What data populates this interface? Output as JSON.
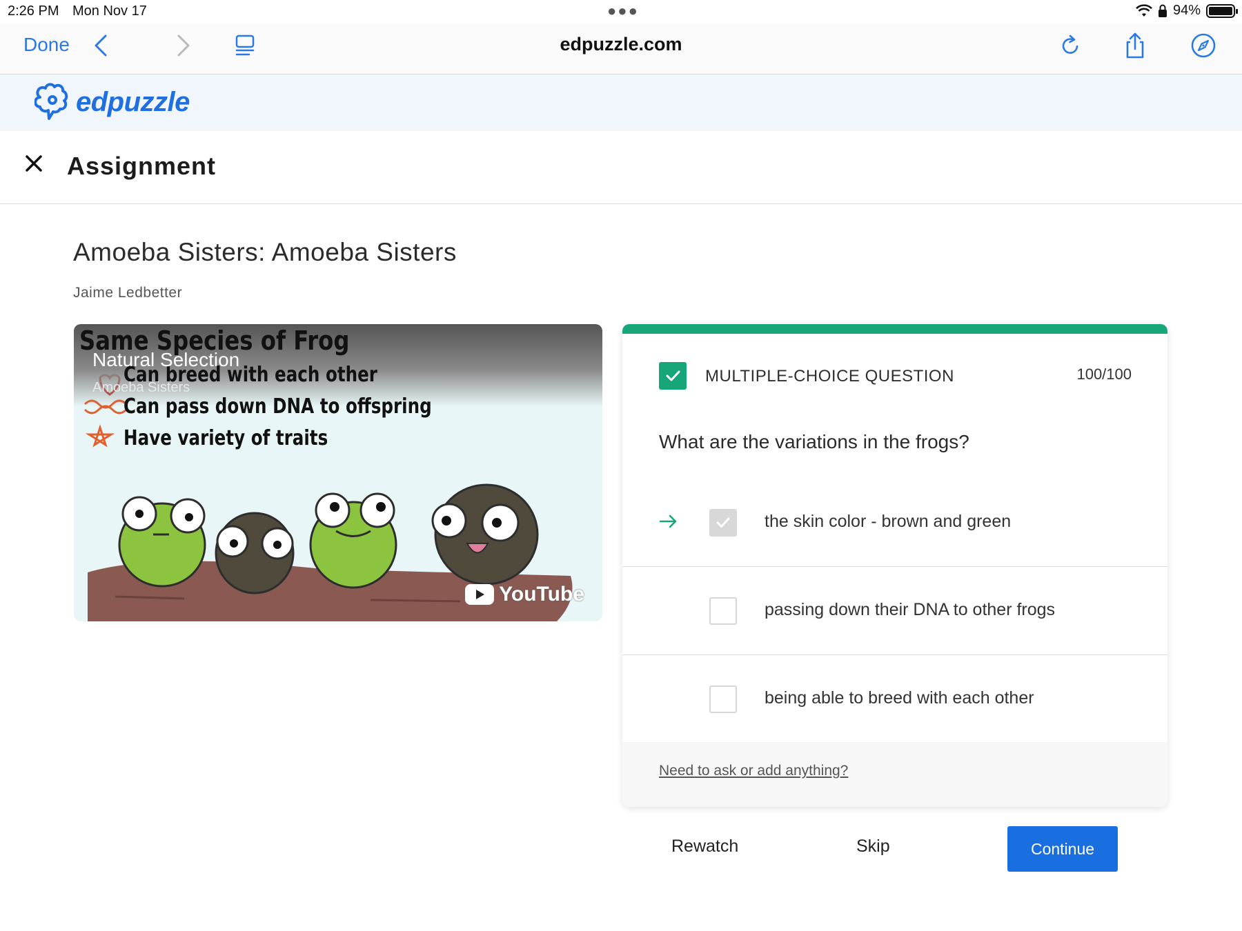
{
  "status_bar": {
    "time": "2:26 PM",
    "date": "Mon Nov 17",
    "battery": "94%"
  },
  "browser": {
    "done_label": "Done",
    "url": "edpuzzle.com"
  },
  "brand": {
    "name": "edpuzzle"
  },
  "header": {
    "title": "Assignment"
  },
  "video": {
    "title": "Amoeba Sisters: Amoeba Sisters",
    "author": "Jaime Ledbetter",
    "frame_heading": "Same Species of Frog",
    "frame_lines": [
      "Can breed with each other",
      "Can pass down DNA to offspring",
      "Have variety of traits"
    ],
    "overlay_title": "Natural Selection",
    "overlay_channel": "Amoeba Sisters",
    "watermark": "YouTube"
  },
  "question": {
    "type_label": "MULTIPLE-CHOICE QUESTION",
    "score": "100/100",
    "prompt": "What are the variations in the frogs?",
    "options": [
      {
        "label": "the skin color - brown and green",
        "checked": true
      },
      {
        "label": "passing down their DNA to other frogs",
        "checked": false
      },
      {
        "label": "being able to breed with each other",
        "checked": false
      }
    ],
    "help_link": "Need to ask or add anything?"
  },
  "actions": {
    "rewatch": "Rewatch",
    "skip": "Skip",
    "continue": "Continue"
  },
  "colors": {
    "accent_blue": "#1a6fe0",
    "correct_green": "#17a57a"
  }
}
